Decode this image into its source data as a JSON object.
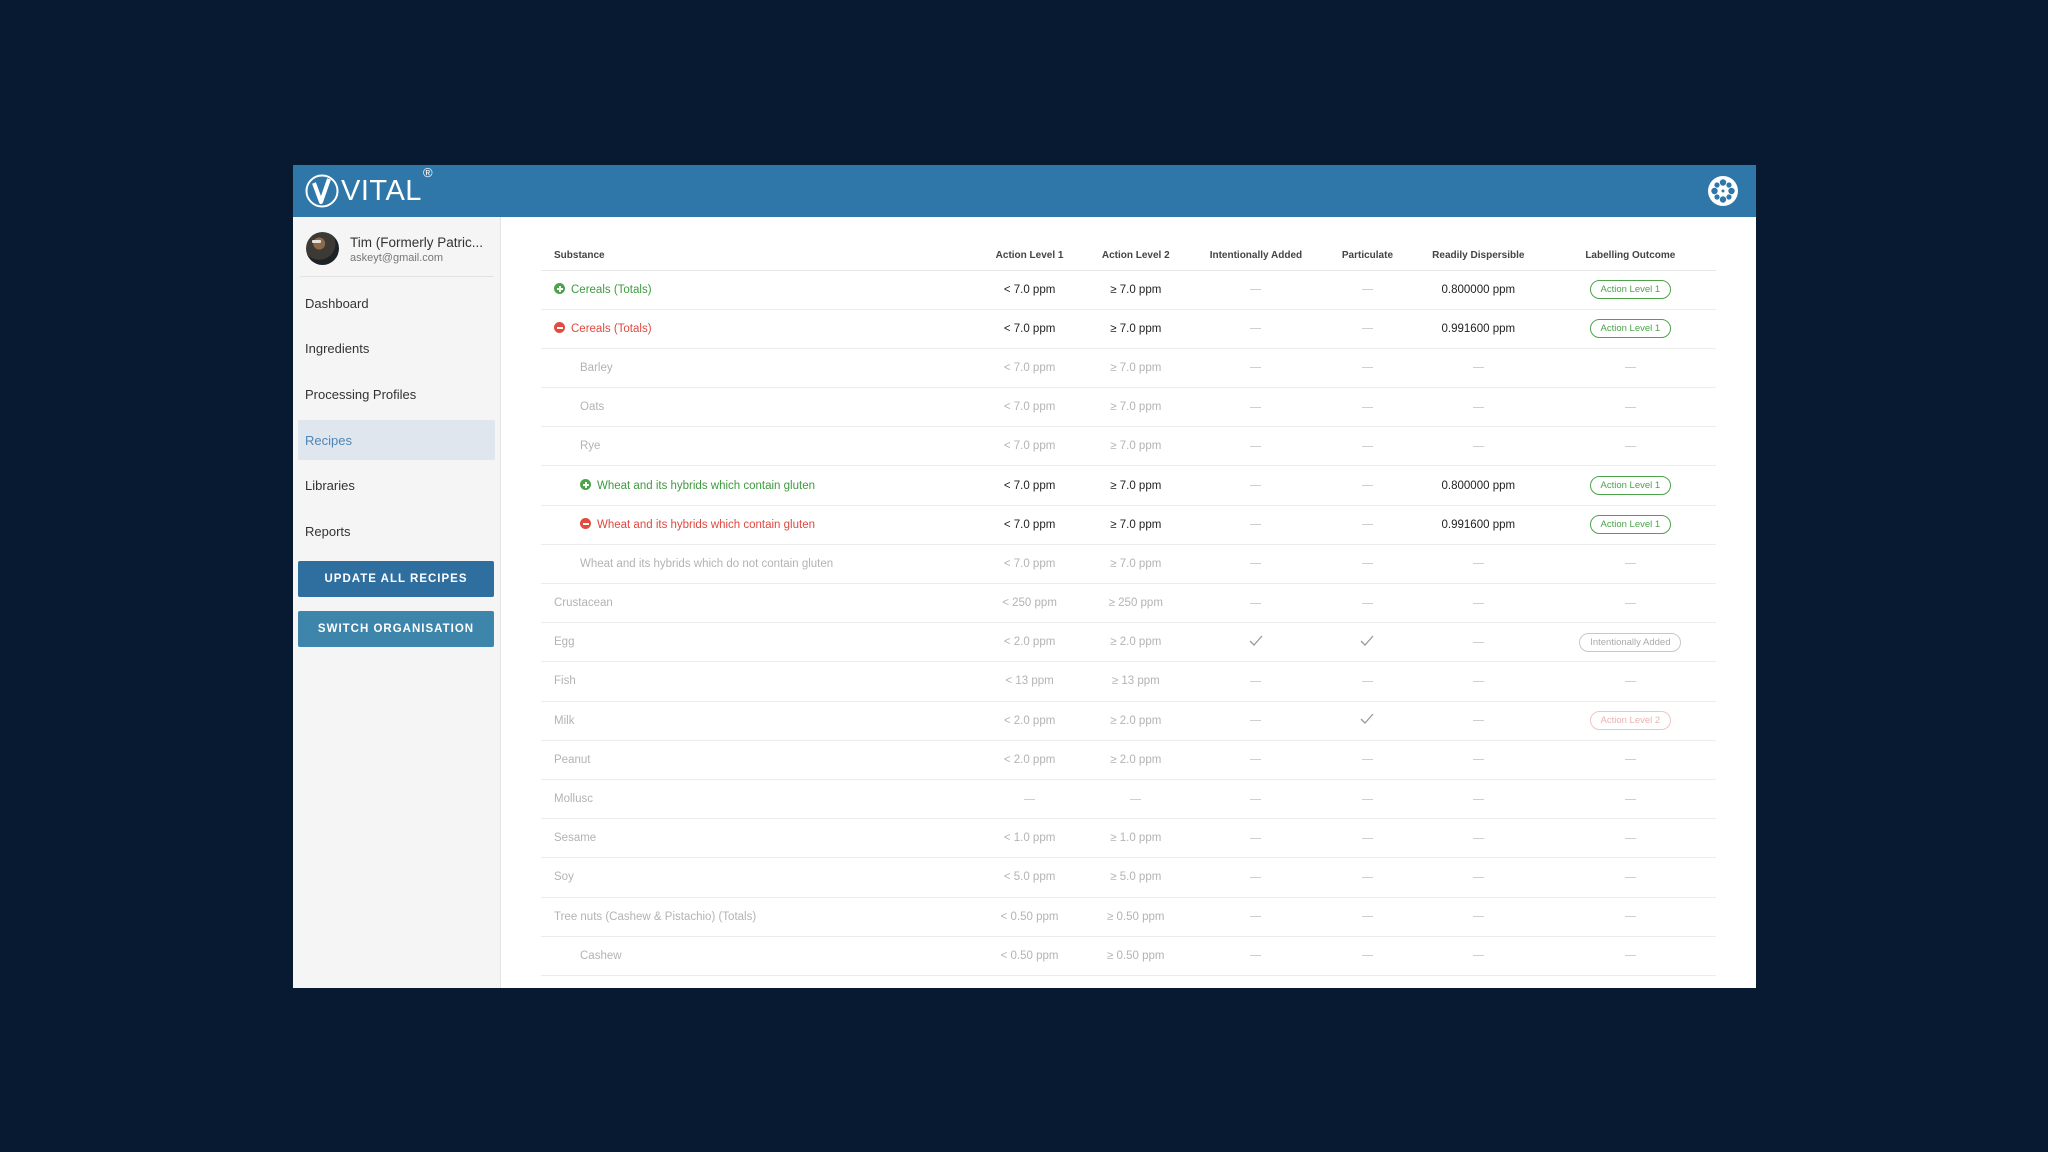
{
  "app": {
    "logo_text": "VITAL",
    "logo_reg": "®"
  },
  "user": {
    "name": "Tim (Formerly Patric...",
    "email": "askeyt@gmail.com"
  },
  "nav": [
    {
      "label": "Dashboard",
      "active": false
    },
    {
      "label": "Ingredients",
      "active": false
    },
    {
      "label": "Processing Profiles",
      "active": false
    },
    {
      "label": "Recipes",
      "active": true
    },
    {
      "label": "Libraries",
      "active": false
    },
    {
      "label": "Reports",
      "active": false
    }
  ],
  "buttons": {
    "update_all": "UPDATE ALL RECIPES",
    "switch_org": "SWITCH ORGANISATION"
  },
  "table": {
    "headers": {
      "substance": "Substance",
      "al1": "Action Level 1",
      "al2": "Action Level 2",
      "intentional": "Intentionally Added",
      "particulate": "Particulate",
      "dispersible": "Readily Dispersible",
      "outcome": "Labelling Outcome"
    },
    "rows": [
      {
        "substance": "Cereals (Totals)",
        "icon": "plus",
        "indent": 0,
        "style": "strong",
        "al1": "< 7.0 ppm",
        "al2": "≥ 7.0 ppm",
        "intentional": "",
        "particulate": "",
        "dispersible": "0.800000 ppm",
        "outcome": "Action Level 1",
        "badge": "green"
      },
      {
        "substance": "Cereals (Totals)",
        "icon": "minus",
        "indent": 0,
        "style": "strong",
        "al1": "< 7.0 ppm",
        "al2": "≥ 7.0 ppm",
        "intentional": "",
        "particulate": "",
        "dispersible": "0.991600 ppm",
        "outcome": "Action Level 1",
        "badge": "green"
      },
      {
        "substance": "Barley",
        "icon": "",
        "indent": 1,
        "style": "muted",
        "al1": "< 7.0 ppm",
        "al2": "≥ 7.0 ppm",
        "intentional": "",
        "particulate": "",
        "dispersible": "",
        "outcome": "",
        "badge": ""
      },
      {
        "substance": "Oats",
        "icon": "",
        "indent": 1,
        "style": "muted",
        "al1": "< 7.0 ppm",
        "al2": "≥ 7.0 ppm",
        "intentional": "",
        "particulate": "",
        "dispersible": "",
        "outcome": "",
        "badge": ""
      },
      {
        "substance": "Rye",
        "icon": "",
        "indent": 1,
        "style": "muted",
        "al1": "< 7.0 ppm",
        "al2": "≥ 7.0 ppm",
        "intentional": "",
        "particulate": "",
        "dispersible": "",
        "outcome": "",
        "badge": ""
      },
      {
        "substance": "Wheat and its hybrids which contain gluten",
        "icon": "plus",
        "indent": 1,
        "style": "strong",
        "al1": "< 7.0 ppm",
        "al2": "≥ 7.0 ppm",
        "intentional": "",
        "particulate": "",
        "dispersible": "0.800000 ppm",
        "outcome": "Action Level 1",
        "badge": "green"
      },
      {
        "substance": "Wheat and its hybrids which contain gluten",
        "icon": "minus",
        "indent": 1,
        "style": "strong",
        "al1": "< 7.0 ppm",
        "al2": "≥ 7.0 ppm",
        "intentional": "",
        "particulate": "",
        "dispersible": "0.991600 ppm",
        "outcome": "Action Level 1",
        "badge": "green"
      },
      {
        "substance": "Wheat and its hybrids which do not contain gluten",
        "icon": "",
        "indent": 1,
        "style": "muted",
        "al1": "< 7.0 ppm",
        "al2": "≥ 7.0 ppm",
        "intentional": "",
        "particulate": "",
        "dispersible": "",
        "outcome": "",
        "badge": ""
      },
      {
        "substance": "Crustacean",
        "icon": "",
        "indent": 0,
        "style": "muted",
        "al1": "< 250 ppm",
        "al2": "≥ 250 ppm",
        "intentional": "",
        "particulate": "",
        "dispersible": "",
        "outcome": "",
        "badge": ""
      },
      {
        "substance": "Egg",
        "icon": "",
        "indent": 0,
        "style": "muted",
        "al1": "< 2.0 ppm",
        "al2": "≥ 2.0 ppm",
        "intentional": "check",
        "particulate": "check",
        "dispersible": "",
        "outcome": "Intentionally Added",
        "badge": "grey"
      },
      {
        "substance": "Fish",
        "icon": "",
        "indent": 0,
        "style": "muted",
        "al1": "< 13 ppm",
        "al2": "≥ 13 ppm",
        "intentional": "",
        "particulate": "",
        "dispersible": "",
        "outcome": "",
        "badge": ""
      },
      {
        "substance": "Milk",
        "icon": "",
        "indent": 0,
        "style": "muted",
        "al1": "< 2.0 ppm",
        "al2": "≥ 2.0 ppm",
        "intentional": "",
        "particulate": "check",
        "dispersible": "",
        "outcome": "Action Level 2",
        "badge": "pink"
      },
      {
        "substance": "Peanut",
        "icon": "",
        "indent": 0,
        "style": "muted",
        "al1": "< 2.0 ppm",
        "al2": "≥ 2.0 ppm",
        "intentional": "",
        "particulate": "",
        "dispersible": "",
        "outcome": "",
        "badge": ""
      },
      {
        "substance": "Mollusc",
        "icon": "",
        "indent": 0,
        "style": "muted",
        "al1": "",
        "al2": "",
        "intentional": "",
        "particulate": "",
        "dispersible": "",
        "outcome": "",
        "badge": ""
      },
      {
        "substance": "Sesame",
        "icon": "",
        "indent": 0,
        "style": "muted",
        "al1": "< 1.0 ppm",
        "al2": "≥ 1.0 ppm",
        "intentional": "",
        "particulate": "",
        "dispersible": "",
        "outcome": "",
        "badge": ""
      },
      {
        "substance": "Soy",
        "icon": "",
        "indent": 0,
        "style": "muted",
        "al1": "< 5.0 ppm",
        "al2": "≥ 5.0 ppm",
        "intentional": "",
        "particulate": "",
        "dispersible": "",
        "outcome": "",
        "badge": ""
      },
      {
        "substance": "Tree nuts (Cashew & Pistachio) (Totals)",
        "icon": "",
        "indent": 0,
        "style": "muted",
        "al1": "< 0.50 ppm",
        "al2": "≥ 0.50 ppm",
        "intentional": "",
        "particulate": "",
        "dispersible": "",
        "outcome": "",
        "badge": ""
      },
      {
        "substance": "Cashew",
        "icon": "",
        "indent": 1,
        "style": "muted",
        "al1": "< 0.50 ppm",
        "al2": "≥ 0.50 ppm",
        "intentional": "",
        "particulate": "",
        "dispersible": "",
        "outcome": "",
        "badge": ""
      }
    ]
  },
  "colors": {
    "background": "#071a31",
    "topbar": "#2f77a8",
    "green": "#4ca34a",
    "red": "#e0483f",
    "active_nav_bg": "#dfe6ee"
  },
  "icons": {
    "settings": "film-reel-icon",
    "expand": "plus-circle-icon",
    "collapse": "minus-circle-icon",
    "check": "checkmark-icon"
  }
}
